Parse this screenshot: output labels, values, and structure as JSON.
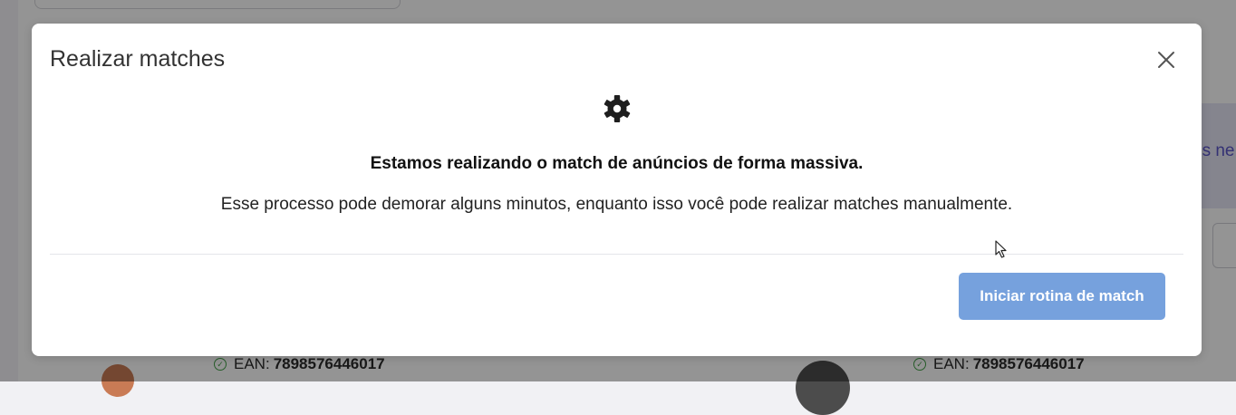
{
  "modal": {
    "title": "Realizar matches",
    "close_icon": "close-icon",
    "status_icon": "gear-icon",
    "headline": "Estamos realizando o match de anúncios de forma massiva.",
    "description": "Esse processo pode demorar alguns minutos, enquanto isso você pode realizar matches manualmente.",
    "primary_button_label": "Iniciar rotina de match",
    "primary_button_color": "#76a1dd"
  },
  "background": {
    "banner_text": "os ne",
    "rows": [
      {
        "ean_label": "EAN:",
        "ean_value": "7898576446017"
      },
      {
        "ean_label": "EAN:",
        "ean_value": "7898576446017"
      }
    ]
  }
}
